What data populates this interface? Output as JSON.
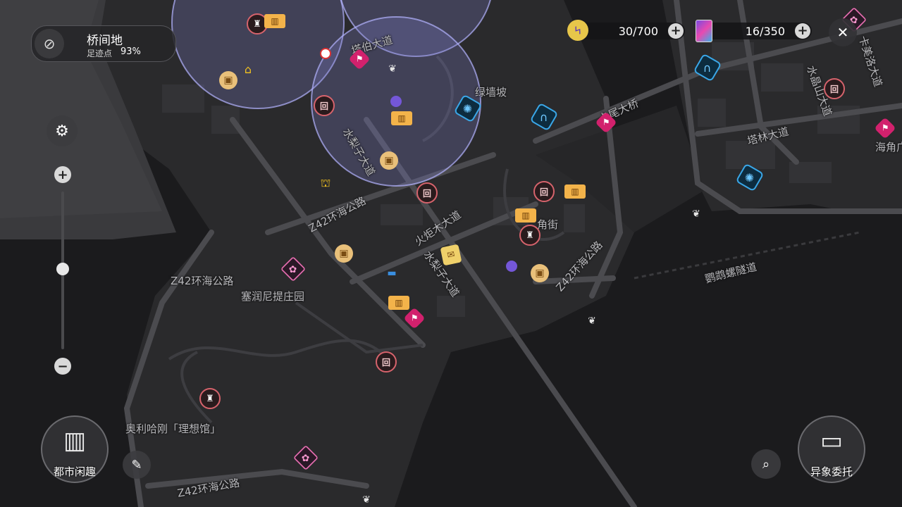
{
  "location": {
    "name": "桥间地",
    "progress_label": "足迹点",
    "progress_value": "93%"
  },
  "resources": [
    {
      "value": "30/700",
      "icon": "battery-charge-icon"
    },
    {
      "value": "16/350",
      "icon": "card-pack-icon"
    }
  ],
  "buttons": {
    "close": "✕",
    "zoom_in": "+",
    "zoom_out": "−",
    "city_fun": "都市闲趣",
    "anomaly": "异象委托"
  },
  "zoom_level": 0.5,
  "map_labels": [
    "塔林大道",
    "卡美洛大道",
    "水晶山大道",
    "海角广",
    "卡尾大桥",
    "绿墙坡",
    "水梨子大道",
    "塔伯大道",
    "Z42环海公路",
    "火炬木大道",
    "角街",
    "水梨子大道",
    "Z42环海公路",
    "鹦鹉螺隧道",
    "Z42环海公路",
    "塞润尼提庄园",
    "奥利哈刚「理想馆」",
    "Z42环海公路"
  ],
  "colors": {
    "accent": "#d2216d",
    "zone": "#8c8cd2",
    "water": "#1a1a1c",
    "land": "#2b2b2d",
    "road": "#4a4a4e"
  }
}
